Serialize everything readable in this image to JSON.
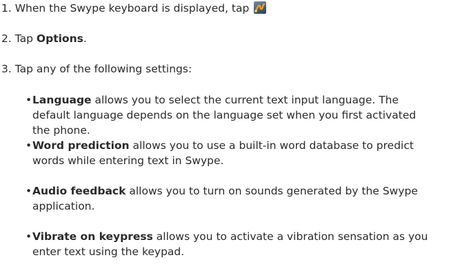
{
  "steps": [
    {
      "number": "1.",
      "text": "When the Swype keyboard is displayed, tap",
      "icon": "swype-icon"
    },
    {
      "number": "2.",
      "text_before": "Tap",
      "bold": "Options",
      "text_after": "."
    },
    {
      "number": "3.",
      "text": "Tap any of the following settings:"
    }
  ],
  "bullets": [
    {
      "bold": "Language",
      "line1": "allows you to select the current text input language. The",
      "line2": "default language depends on the language set when you first activated",
      "line3": "the phone."
    },
    {
      "bold": "Word prediction",
      "line1": "allows you to use a built-in word database to predict",
      "line2": "words while entering text in Swype."
    },
    {
      "bold": "Audio feedback",
      "line1": "allows you to turn on sounds generated by the Swype",
      "line2": "application."
    },
    {
      "bold": "Vibrate on keypress",
      "line1": "allows you to activate a vibration sensation as you",
      "line2": "enter text using the keypad."
    }
  ],
  "colors": {
    "text": "#2a2a2a",
    "icon_bg": "#4d5f75",
    "icon_swoosh": "#f0a020"
  }
}
